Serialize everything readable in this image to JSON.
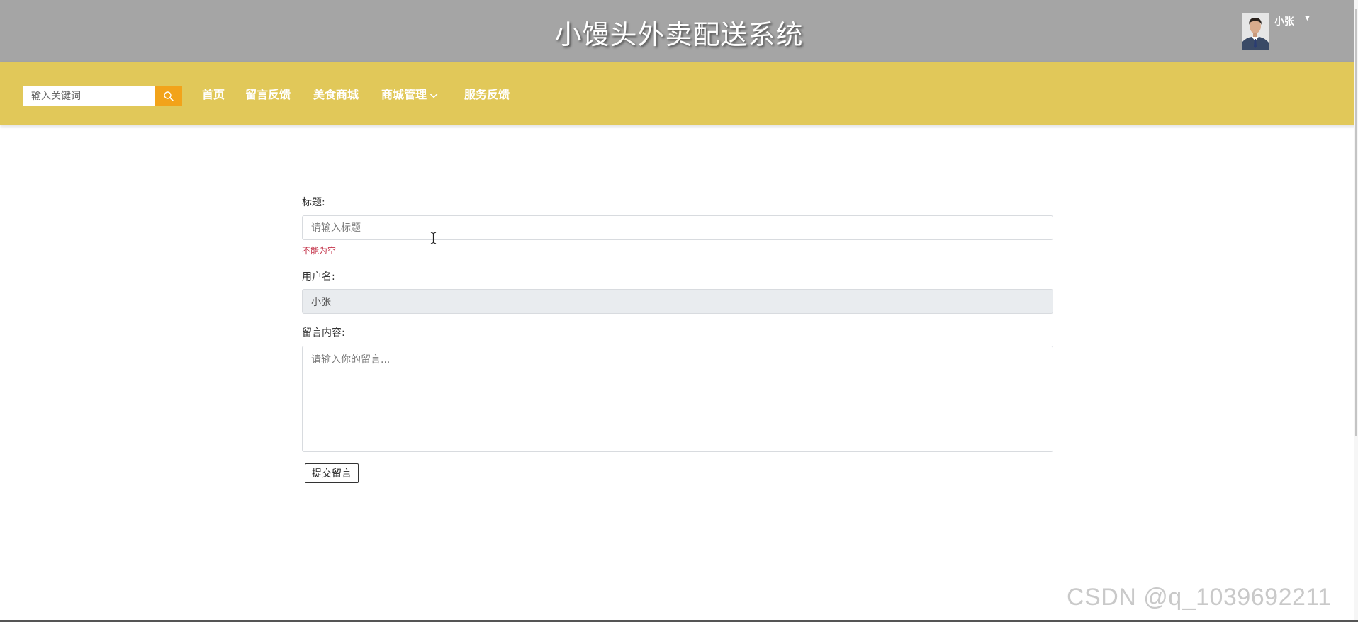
{
  "header": {
    "site_title": "小馒头外卖配送系统",
    "user": {
      "name": "小张",
      "avatar_icon": "user-avatar-photo"
    }
  },
  "nav": {
    "search": {
      "placeholder": "输入关键词",
      "value": "",
      "icon": "search-icon"
    },
    "items": [
      {
        "label": "首页"
      },
      {
        "label": "留言反馈"
      },
      {
        "label": "美食商城"
      },
      {
        "label": "商城管理",
        "has_dropdown": true
      },
      {
        "label": "服务反馈"
      }
    ]
  },
  "form": {
    "title_label": "标题:",
    "title_placeholder": "请输入标题",
    "title_value": "",
    "title_error": "不能为空",
    "username_label": "用户名:",
    "username_value": "小张",
    "content_label": "留言内容:",
    "content_placeholder": "请输入你的留言...",
    "submit_label": "提交留言"
  },
  "watermark": "CSDN @q_1039692211",
  "colors": {
    "header_bg": "#a5a5a5",
    "nav_bg": "#e1c859",
    "search_button": "#f2a31a",
    "error": "#c4344a"
  }
}
